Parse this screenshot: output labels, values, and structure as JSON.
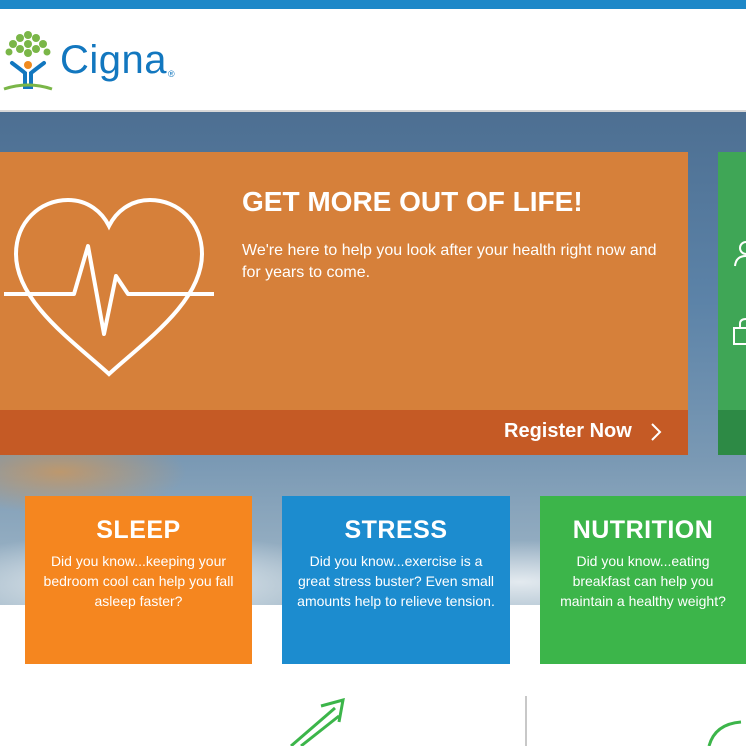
{
  "header": {
    "brand": "Cigna",
    "brand_reg": "®",
    "logo_icon": "cigna-tree-person-icon"
  },
  "hero": {
    "title": "GET MORE OUT OF LIFE!",
    "text": "We're here to help you look after your health right now and for years to come.",
    "cta_label": "Register Now",
    "icon": "heart-pulse-icon"
  },
  "side_panel": {
    "icons": [
      "user-icon",
      "lock-icon"
    ]
  },
  "tiles": [
    {
      "title": "SLEEP",
      "text": "Did you know...keeping your bedroom cool can help you fall asleep faster?",
      "color": "#f5861f"
    },
    {
      "title": "STRESS",
      "text": "Did you know...exercise is a great stress buster? Even small amounts help to relieve tension.",
      "color": "#1c8ccf"
    },
    {
      "title": "NUTRITION",
      "text": "Did you know...eating breakfast can help you maintain a healthy weight?",
      "color": "#3cb54a"
    }
  ],
  "colors": {
    "brand_blue": "#1277bf",
    "hero_orange": "#d6803a",
    "cta_band": "#c55a25",
    "side_green": "#3fa656"
  },
  "bottom_icons": [
    "trending-up-arrow-icon",
    "leaf-icon"
  ]
}
